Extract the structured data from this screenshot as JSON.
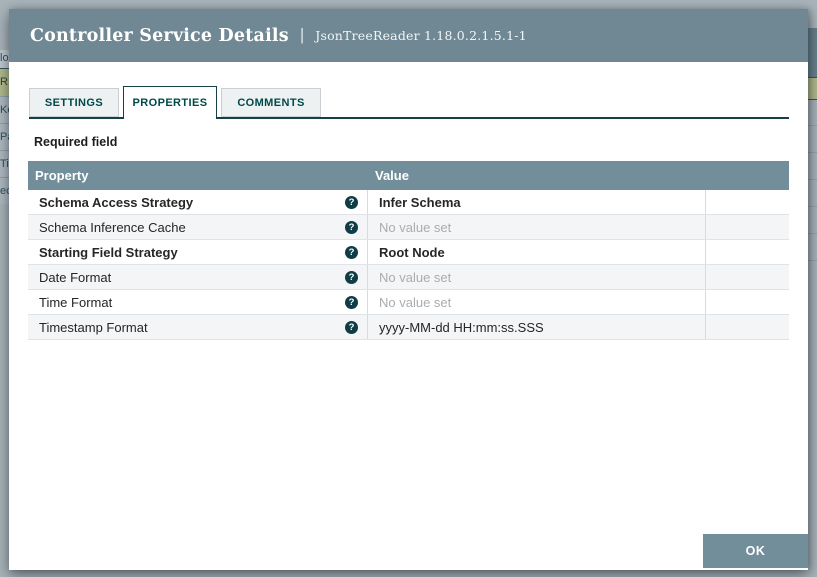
{
  "page": {
    "background_fragments": {
      "left": [
        "lo",
        "R",
        "Ke",
        "Pa",
        "Ti",
        "ec"
      ]
    }
  },
  "dialog": {
    "title": "Controller Service Details",
    "title_separator": "|",
    "subtitle": "JsonTreeReader 1.18.0.2.1.5.1-1",
    "tabs": [
      {
        "label": "SETTINGS"
      },
      {
        "label": "PROPERTIES"
      },
      {
        "label": "COMMENTS"
      }
    ],
    "active_tab": "PROPERTIES",
    "required_field_label": "Required field",
    "properties_table": {
      "columns": [
        "Property",
        "Value"
      ],
      "rows": [
        {
          "property": "Schema Access Strategy",
          "value": "Infer Schema",
          "required": true,
          "value_set": true
        },
        {
          "property": "Schema Inference Cache",
          "value": "No value set",
          "required": false,
          "value_set": false
        },
        {
          "property": "Starting Field Strategy",
          "value": "Root Node",
          "required": true,
          "value_set": true
        },
        {
          "property": "Date Format",
          "value": "No value set",
          "required": false,
          "value_set": false
        },
        {
          "property": "Time Format",
          "value": "No value set",
          "required": false,
          "value_set": false
        },
        {
          "property": "Timestamp Format",
          "value": "yyyy-MM-dd HH:mm:ss.SSS",
          "required": false,
          "value_set": true
        }
      ]
    },
    "ok_button_label": "OK"
  },
  "icons": {
    "help": "question-circle-icon"
  },
  "colors": {
    "dialog_header_bg": "#6f8894",
    "table_header_bg": "#728e9b",
    "accent_teal": "#004849",
    "tab_line": "#173f47",
    "background_highlight_row": "#b3ba8c",
    "unset_value_text": "#a9adaf",
    "ok_button_bg": "#728e9b",
    "alt_row_bg": "#f3f5f6"
  }
}
